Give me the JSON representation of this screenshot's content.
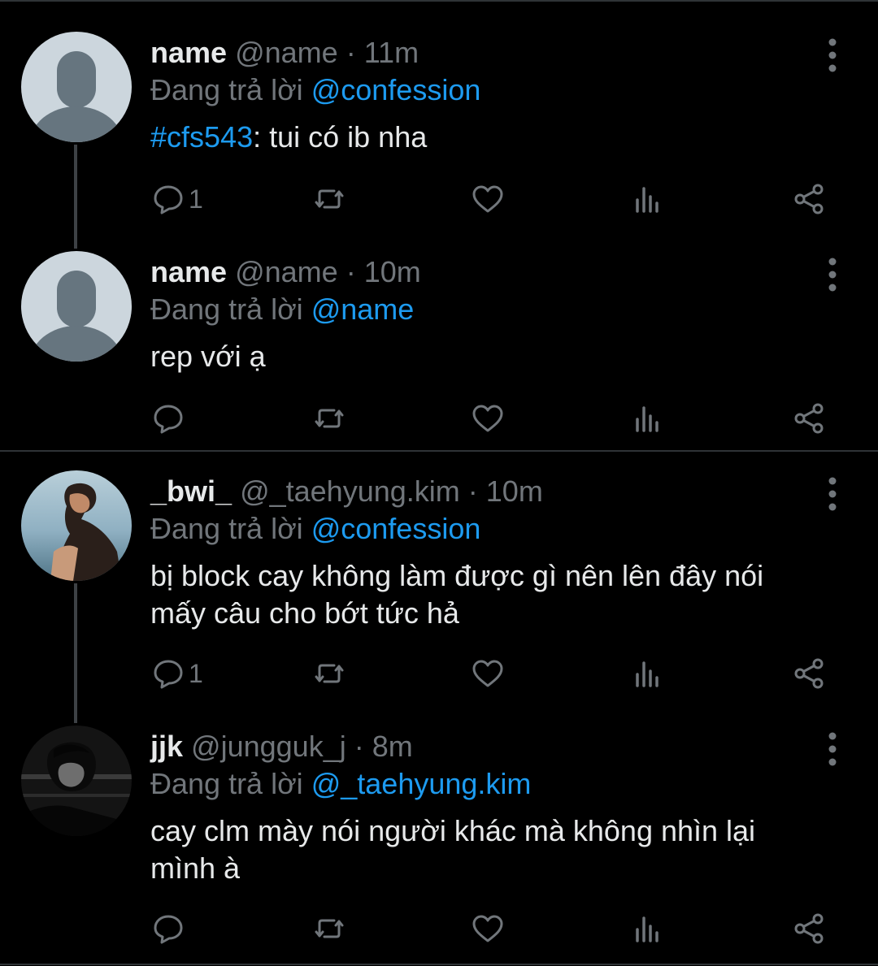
{
  "tweets": [
    {
      "display_name": "name",
      "handle": "@name",
      "separator": "·",
      "time": "11m",
      "replying_prefix": "Đang trả lời",
      "replying_to": "@confession",
      "hashtag": "#cfs543",
      "text": ": tui có ib nha",
      "reply_count": "1"
    },
    {
      "display_name": "name",
      "handle": "@name",
      "separator": "·",
      "time": "10m",
      "replying_prefix": "Đang trả lời",
      "replying_to": "@name",
      "text": "rep với ạ",
      "reply_count": ""
    },
    {
      "display_name": "_bwi_",
      "handle": "@_taehyung.kim",
      "separator": "·",
      "time": "10m",
      "replying_prefix": "Đang trả lời",
      "replying_to": "@confession",
      "text": "bị block cay không làm được gì nên lên đây nói mấy câu cho bớt tức hả",
      "reply_count": "1"
    },
    {
      "display_name": "jjk",
      "handle": "@jungguk_j",
      "separator": "·",
      "time": "8m",
      "replying_prefix": "Đang trả lời",
      "replying_to": "@_taehyung.kim",
      "text": "cay clm mày nói người khác mà không nhìn lại mình à",
      "reply_count": ""
    }
  ],
  "icons": {
    "reply": "reply-icon",
    "retweet": "retweet-icon",
    "like": "like-icon",
    "views": "views-icon",
    "share": "share-icon",
    "more": "more-vertical-icon"
  },
  "colors": {
    "background": "#000000",
    "text_primary": "#e7e9ea",
    "text_secondary": "#71767b",
    "accent": "#1d9bf0",
    "divider": "#2f3336"
  }
}
